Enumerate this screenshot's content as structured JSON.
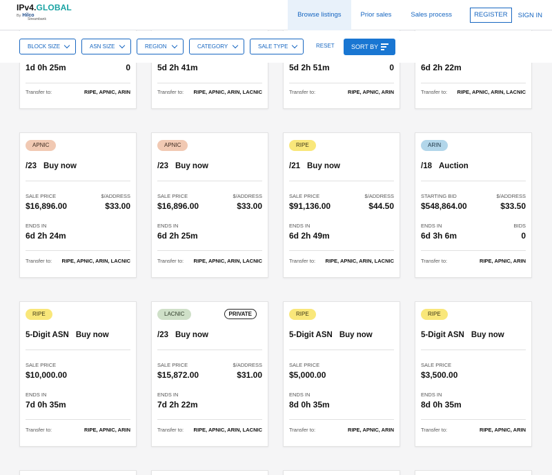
{
  "header": {
    "logo_text": "IPv4.",
    "logo_text_accent": "GLOBAL",
    "logo_by": "By",
    "logo_partner": "Hilco",
    "logo_partner_sub": "Streambank",
    "nav": {
      "browse": "Browse listings",
      "prior": "Prior sales",
      "process": "Sales process",
      "register": "REGISTER",
      "signin": "SIGN IN"
    }
  },
  "filters": {
    "block_size": "BLOCK SIZE",
    "asn_size": "ASN SIZE",
    "region": "REGION",
    "category": "CATEGORY",
    "sale_type": "SALE TYPE",
    "reset": "RESET",
    "sort_by": "SORT BY"
  },
  "labels": {
    "transfer_to": "Transfer to:",
    "sale_price": "SALE PRICE",
    "starting_bid": "STARTING BID",
    "per_address": "$/ADDRESS",
    "ends_in": "ENDS IN",
    "bids": "BIDS",
    "private": "PRIVATE"
  },
  "row0": [
    {
      "ends": "1d 0h 25m",
      "right_val": "0",
      "transfer": "RIPE, APNIC, ARIN"
    },
    {
      "ends": "5d 2h 41m",
      "right_val": "",
      "transfer": "RIPE, APNIC, ARIN, LACNIC"
    },
    {
      "ends": "5d 2h 51m",
      "right_val": "0",
      "transfer": "RIPE, APNIC, ARIN"
    },
    {
      "ends": "6d 2h 22m",
      "right_val": "",
      "transfer": "RIPE, APNIC, ARIN, LACNIC"
    }
  ],
  "row1": [
    {
      "region": "APNIC",
      "size": "/23",
      "type": "Buy now",
      "price": "$16,896.00",
      "per_address": "$33.00",
      "ends": "6d 2h 24m",
      "transfer": "RIPE, APNIC, ARIN, LACNIC"
    },
    {
      "region": "APNIC",
      "size": "/23",
      "type": "Buy now",
      "price": "$16,896.00",
      "per_address": "$33.00",
      "ends": "6d 2h 25m",
      "transfer": "RIPE, APNIC, ARIN, LACNIC"
    },
    {
      "region": "RIPE",
      "size": "/21",
      "type": "Buy now",
      "price": "$91,136.00",
      "per_address": "$44.50",
      "ends": "6d 2h 49m",
      "transfer": "RIPE, APNIC, ARIN, LACNIC"
    },
    {
      "region": "ARIN",
      "size": "/18",
      "type": "Auction",
      "price": "$548,864.00",
      "per_address": "$33.50",
      "ends": "6d 3h 6m",
      "bids": "0",
      "transfer": "RIPE, APNIC, ARIN"
    }
  ],
  "row2": [
    {
      "region": "RIPE",
      "size": "5-Digit ASN",
      "type": "Buy now",
      "price": "$10,000.00",
      "ends": "7d 0h 35m",
      "transfer": "RIPE, APNIC, ARIN"
    },
    {
      "region": "LACNIC",
      "size": "/23",
      "type": "Buy now",
      "price": "$15,872.00",
      "per_address": "$31.00",
      "ends": "7d 2h 22m",
      "transfer": "RIPE, APNIC, ARIN, LACNIC"
    },
    {
      "region": "RIPE",
      "size": "5-Digit ASN",
      "type": "Buy now",
      "price": "$5,000.00",
      "ends": "8d 0h 35m",
      "transfer": "RIPE, APNIC, ARIN"
    },
    {
      "region": "RIPE",
      "size": "5-Digit ASN",
      "type": "Buy now",
      "price": "$3,500.00",
      "ends": "8d 0h 35m",
      "transfer": "RIPE, APNIC, ARIN"
    }
  ],
  "colors": {
    "accent": "#1565c0",
    "sort_button": "#1976d2",
    "apnic": "#f1c9b3",
    "ripe": "#f9e77a",
    "arin": "#b2d6ea",
    "lacnic": "#cfe0c8"
  }
}
